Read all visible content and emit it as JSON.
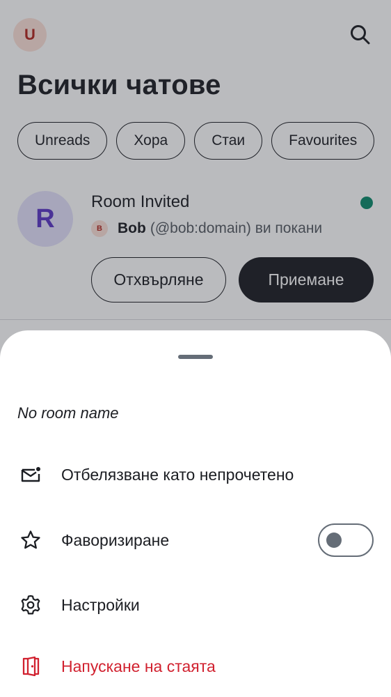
{
  "header": {
    "avatar_letter": "U",
    "title": "Всички чатове",
    "search_icon": "search-icon"
  },
  "filters": [
    "Unreads",
    "Хора",
    "Стаи",
    "Favourites"
  ],
  "invite": {
    "avatar_letter": "R",
    "room_name": "Room Invited",
    "inviter_avatar_letter": "B",
    "inviter_name": "Bob",
    "inviter_text": "(@bob:domain) ви покани",
    "reject_label": "Отхвърляне",
    "accept_label": "Приемане"
  },
  "sheet": {
    "title": "No room name",
    "items": [
      {
        "label": "Отбелязване като непрочетено",
        "icon": "mark-unread-icon"
      },
      {
        "label": "Фаворизиране",
        "icon": "star-icon",
        "toggle_on": false
      },
      {
        "label": "Настройки",
        "icon": "settings-icon"
      },
      {
        "label": "Напускане на стаята",
        "icon": "leave-room-icon",
        "color": "#d1212f"
      }
    ]
  }
}
